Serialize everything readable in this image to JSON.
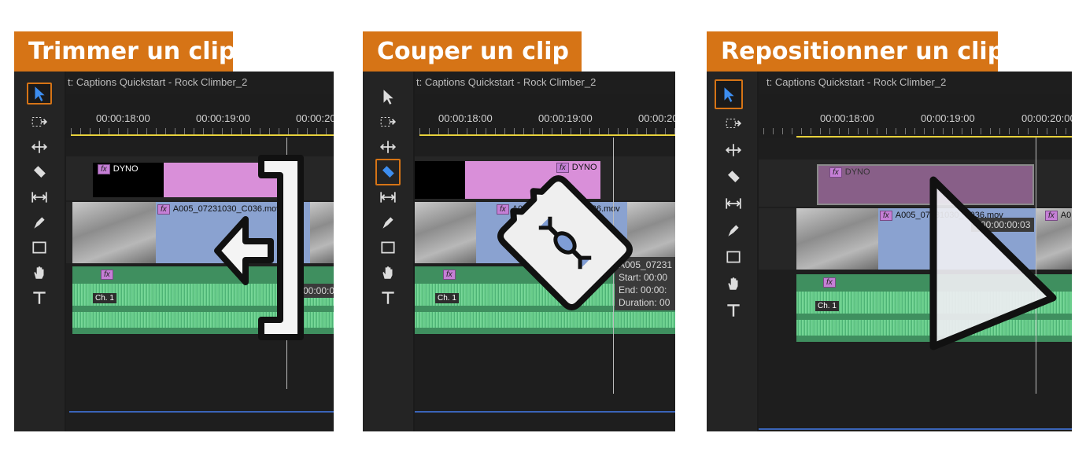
{
  "panels": [
    {
      "heading": "Trimmer un clip",
      "sequence": "t: Captions Quickstart - Rock Climber_2",
      "timecodes": [
        "00:00:18:00",
        "00:00:19:00",
        "00:00:20"
      ],
      "graphic_label": "DYNO",
      "video_clip": "A005_07231030_C036.mov",
      "audio_channel": "Ch. 1",
      "tooltip_lines": [
        "00:00:0"
      ],
      "selected_tool": "selection-tool",
      "overlay": "trim-icon"
    },
    {
      "heading": "Couper un clip",
      "sequence": "t: Captions Quickstart - Rock Climber_2",
      "timecodes": [
        "00:00:18:00",
        "00:00:19:00",
        "00:00:20"
      ],
      "graphic_label": "DYNO",
      "video_clip": "A005_07231030_C036.mov",
      "audio_channel": "Ch. 1",
      "tooltip_lines": [
        "A005_07231",
        "Start: 00:00",
        "End: 00:00:",
        "Duration: 00"
      ],
      "selected_tool": "razor-tool",
      "overlay": "razor-blade-icon"
    },
    {
      "heading": "Repositionner un clip",
      "sequence": "t: Captions Quickstart - Rock Climber_2",
      "timecodes": [
        "00:00:18:00",
        "00:00:19:00",
        "00:00:20:00"
      ],
      "graphic_label": "DYNO",
      "video_clip": "A005_07231030_C036.mov",
      "video_clip_second": "A0",
      "audio_channel": "Ch. 1",
      "tooltip_lines": [
        "+00:00:00:03"
      ],
      "selected_tool": "selection-tool",
      "overlay": "arrow-cursor-icon"
    }
  ],
  "colors": {
    "accent": "#d67416",
    "graphic_clip": "#d98fd9",
    "video_clip": "#8aa2d0",
    "audio": "#4fb779",
    "playbar": "#e8d23c"
  }
}
